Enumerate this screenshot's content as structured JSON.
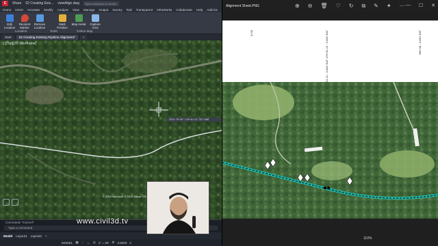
{
  "colors": {
    "cad_bg": "#1e2127",
    "ribbon": "#353a45",
    "viewer_bg": "#1f1f1f",
    "pipeline_line": "#1fb8a6",
    "alignment_line": "#222222"
  },
  "cad": {
    "titlebar": {
      "share": "Share",
      "document": "02 Creating Exis...",
      "file": "viewAlign.dwg",
      "search_placeholder": "Type a keyword or phrase"
    },
    "menu": [
      "Home",
      "Insert",
      "Annotate",
      "Modify",
      "Analyze",
      "View",
      "Manage",
      "Output",
      "Survey",
      "Rail",
      "Transparent",
      "InfraWorks",
      "Collaborate",
      "Help",
      "Add-ins"
    ],
    "ribbon": {
      "buttons": [
        {
          "label": "Edit Location",
          "icon": "geolocation-icon"
        },
        {
          "label": "Reorient Marker",
          "icon": "map-pin-icon"
        },
        {
          "label": "Remove Location",
          "icon": "remove-location-icon"
        },
        {
          "label": "Mark Position",
          "icon": "mark-position-icon"
        },
        {
          "label": "Map Aerial",
          "icon": "aerial-map-icon"
        },
        {
          "label": "Capture Area",
          "icon": "capture-area-icon"
        }
      ],
      "groups": [
        "Location",
        "Tools",
        "Online Map"
      ]
    },
    "tabs": [
      "Start",
      "02 Creating Existing Pipeline Alignment*",
      "+"
    ],
    "viewport_label": "[-][Top][2D Wireframe]",
    "tooltip": "3257.7ft  90°  176+61.21'  327.988",
    "copyright": "© 2019 Microsoft © 2019 Maxar ©CNES (2019) Distribution Airbus DS",
    "command_history": "Command: *Cancel*",
    "command_placeholder": "Type a command",
    "layout_tabs": [
      "Model",
      "Layout1",
      "Layout2",
      "+"
    ],
    "status": {
      "mode": "MODEL",
      "scale": "1\" = 20'",
      "zoom": "3.5000"
    }
  },
  "watermark": "www.civil3d.tv",
  "viewer": {
    "file_name": "Alignment Sheet.PNG",
    "tools": [
      "zoom-in-icon",
      "zoom-out-icon",
      "delete-icon",
      "favorite-icon",
      "rotate-icon",
      "crop-icon",
      "edit-icon",
      "ai-icon",
      "more-icon"
    ],
    "stations": [
      "0+00",
      "176+61.21 - 0.000' EAT\n176+61.21 - 0.000' EAT",
      "360+00 - 0.000' EAT"
    ],
    "zoom_level": "110%"
  }
}
